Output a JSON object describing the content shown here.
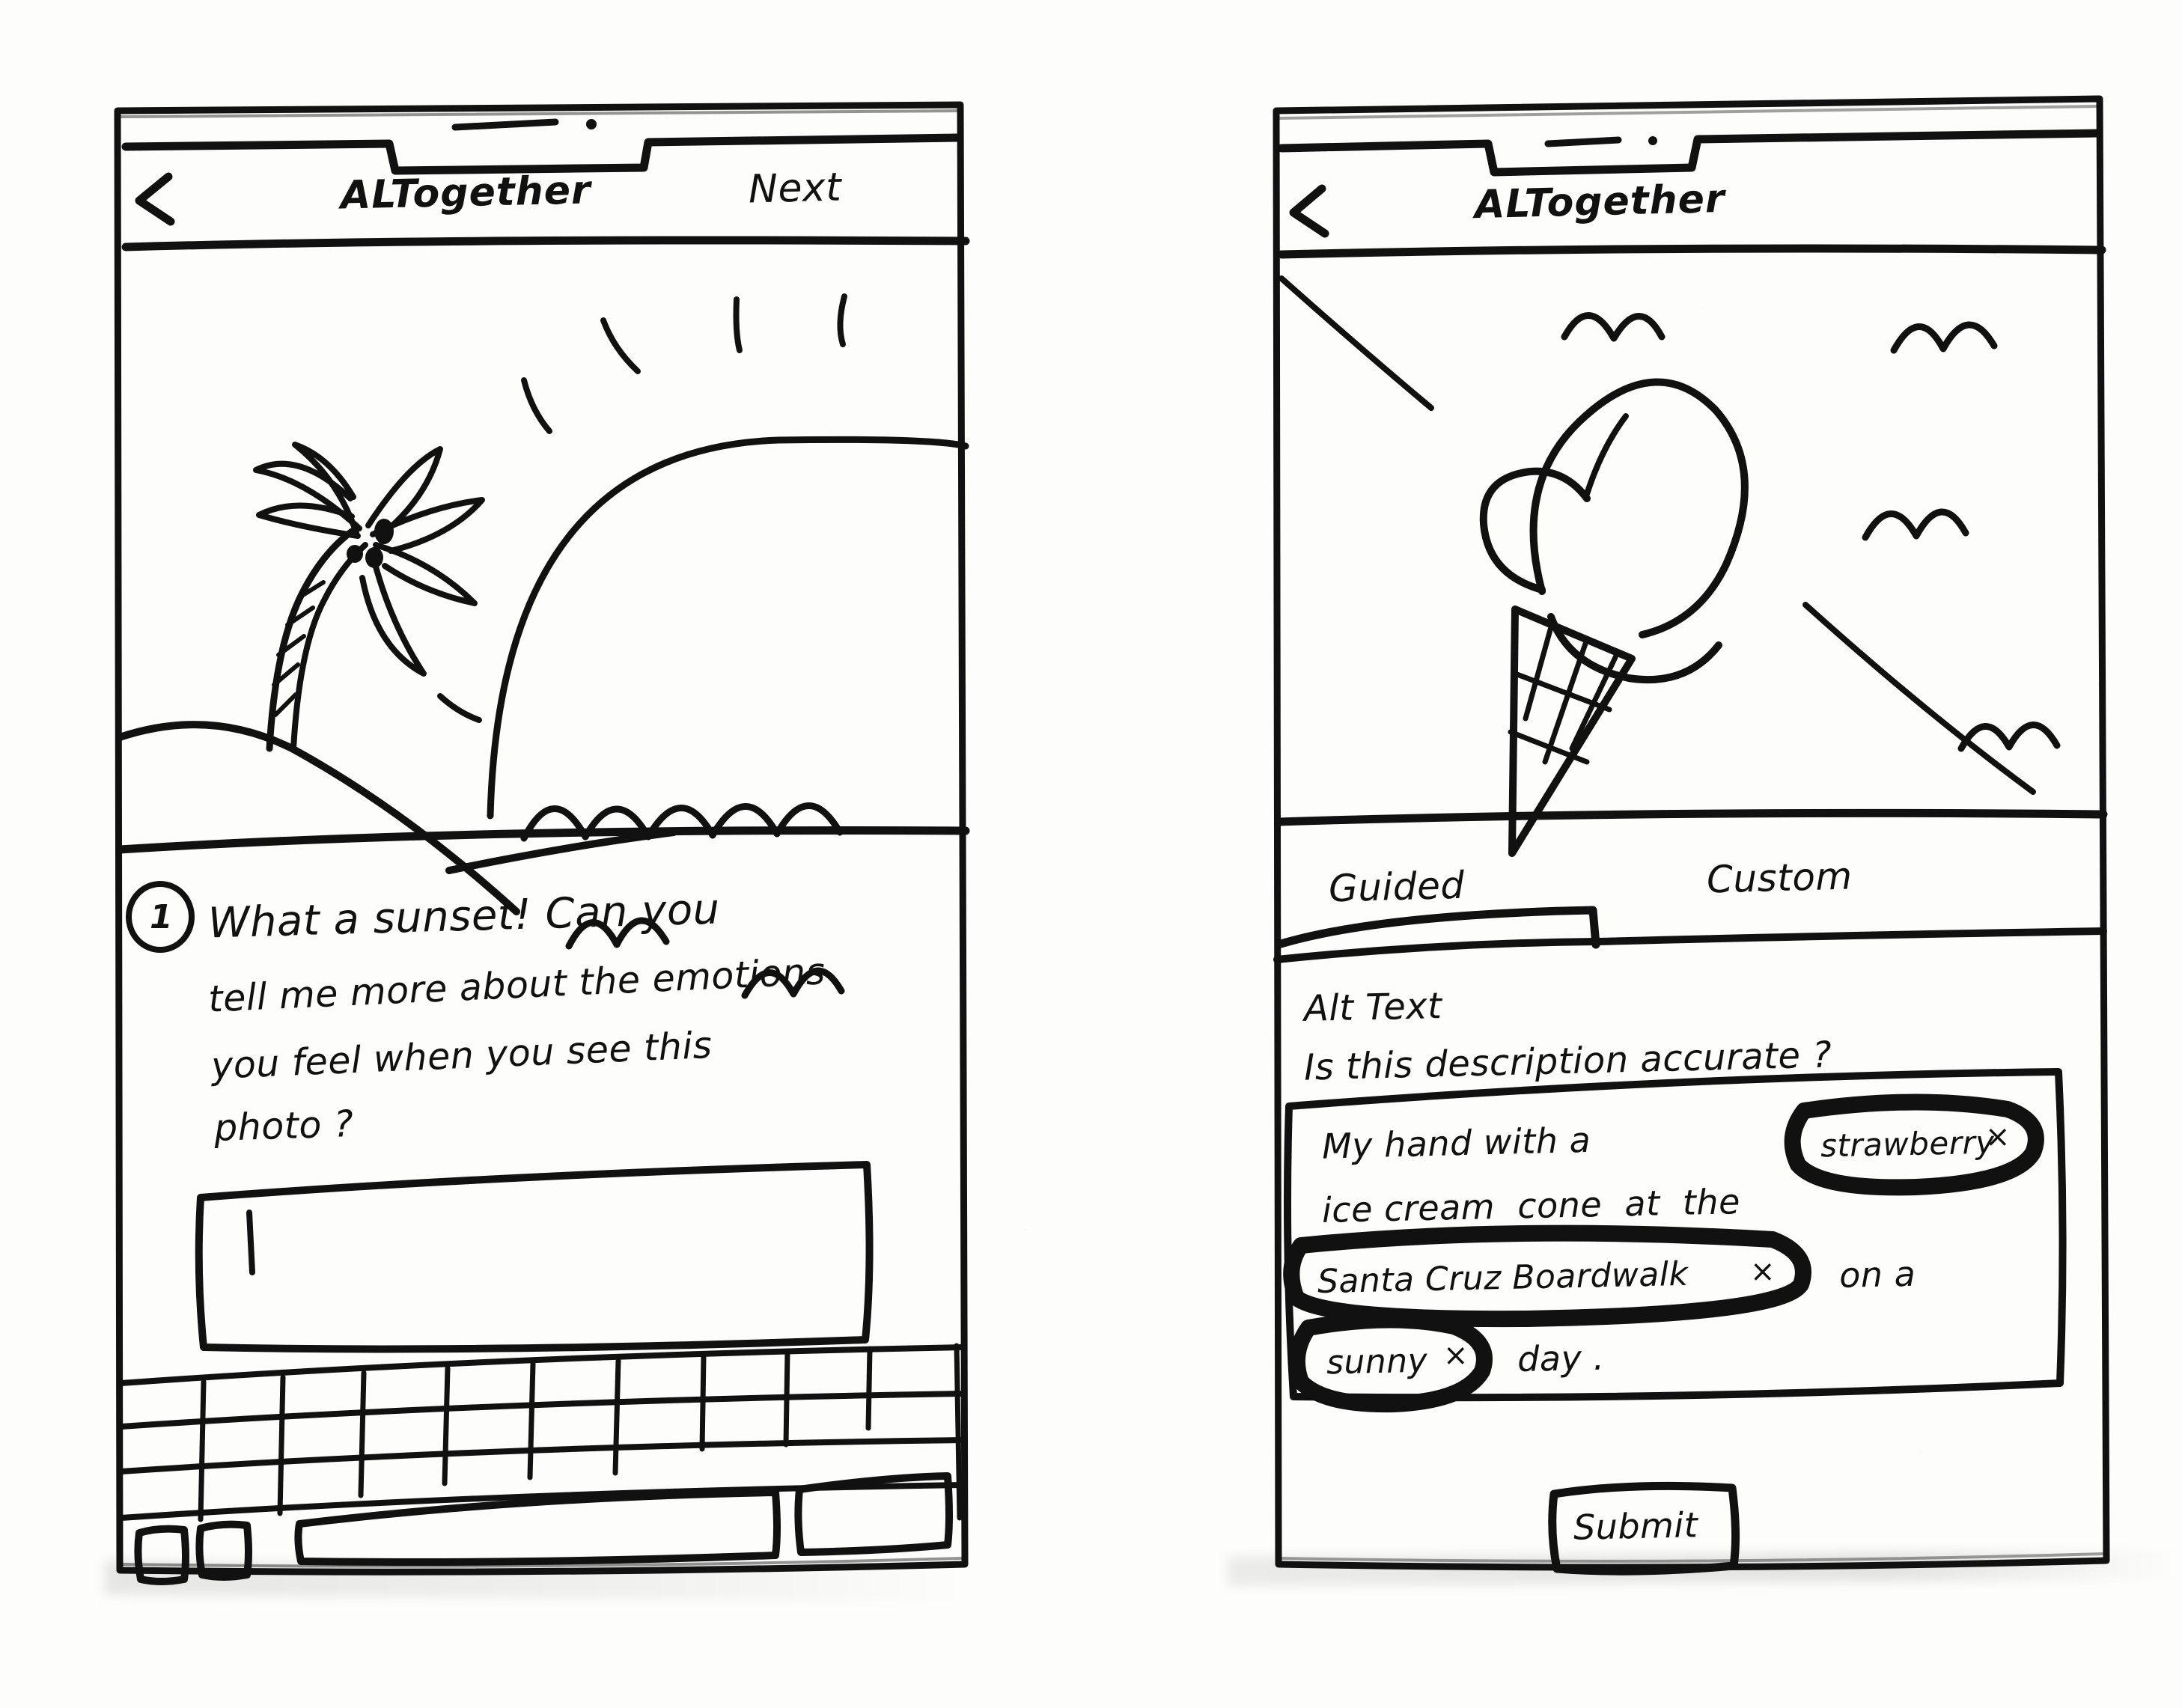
{
  "meta": {
    "kind": "hand-drawn wireframe sketch",
    "screens": 2,
    "ink_color": "#111111",
    "paper_color": "#fdfdfc"
  },
  "screen_left": {
    "name": "guided-question-screen",
    "header": {
      "back_icon": "chevron-left-icon",
      "back_label": "<",
      "title": "ALTogether",
      "action_label": "Next"
    },
    "photo": {
      "alt_name": "beach-sunset-illustration",
      "description": "sunset over the ocean with a palm tree on a hill, waves and birds"
    },
    "question": {
      "number": "1",
      "lines": [
        "What a sunset! Can you",
        "tell me more about the emotions",
        "you feel when you see this",
        "photo ?"
      ]
    },
    "answer_input": {
      "value": "",
      "placeholder": "",
      "cursor": true
    },
    "keyboard": {
      "name": "on-screen-keyboard",
      "rows": 4,
      "bottom_keys": [
        "key-1",
        "key-2",
        "space-bar",
        "return-key"
      ]
    }
  },
  "screen_right": {
    "name": "alt-text-review-screen",
    "header": {
      "back_icon": "chevron-left-icon",
      "back_label": "<",
      "title": "ALTogether",
      "action_label": ""
    },
    "photo": {
      "alt_name": "ice-cream-cone-illustration",
      "description": "a strawberry ice cream cone held up against the sky with birds"
    },
    "tabs": [
      {
        "label": "Guided",
        "active": true
      },
      {
        "label": "Custom",
        "active": false
      }
    ],
    "alt_text": {
      "heading": "Alt Text",
      "prompt": "Is this description accurate ?",
      "segments": [
        {
          "type": "text",
          "value": "My hand with a "
        },
        {
          "type": "chip",
          "value": "strawberry",
          "remove_icon": "x-icon"
        },
        {
          "type": "break"
        },
        {
          "type": "text",
          "value": "ice cream  cone  at  the"
        },
        {
          "type": "break"
        },
        {
          "type": "chip",
          "value": "Santa Cruz Boardwalk",
          "remove_icon": "x-icon"
        },
        {
          "type": "text",
          "value": " on a"
        },
        {
          "type": "break"
        },
        {
          "type": "chip",
          "value": "sunny",
          "remove_icon": "x-icon"
        },
        {
          "type": "text",
          "value": " day ."
        }
      ]
    },
    "submit": {
      "label": "Submit"
    }
  }
}
